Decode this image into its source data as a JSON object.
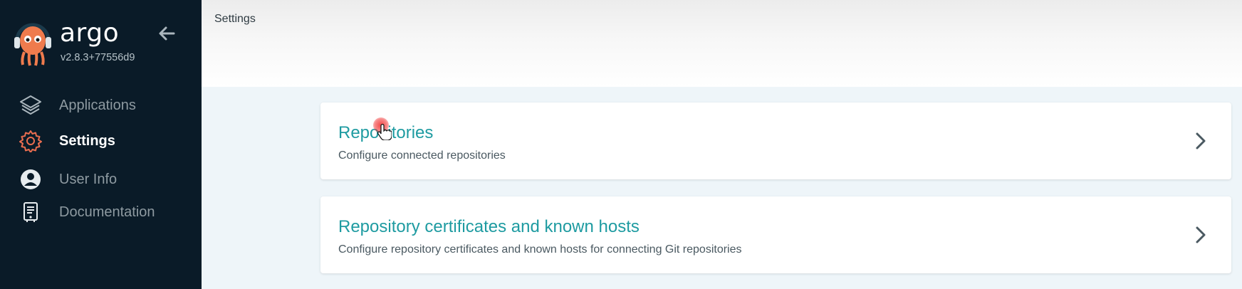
{
  "sidebar": {
    "logo_text": "argo",
    "version": "v2.8.3+77556d9",
    "items": [
      {
        "label": "Applications",
        "icon": "layers-icon"
      },
      {
        "label": "Settings",
        "icon": "gear-icon",
        "active": true
      },
      {
        "label": "User Info",
        "icon": "user-circle-icon"
      },
      {
        "label": "Documentation",
        "icon": "book-icon"
      }
    ]
  },
  "header": {
    "breadcrumb": "Settings"
  },
  "main": {
    "cards": [
      {
        "title": "Repositories",
        "description": "Configure connected repositories"
      },
      {
        "title": "Repository certificates and known hosts",
        "description": "Configure repository certificates and known hosts for connecting Git repositories"
      }
    ]
  },
  "colors": {
    "sidebar_bg": "#0a1b28",
    "accent_teal": "#1e9ba1",
    "active_icon": "#e96d50"
  }
}
